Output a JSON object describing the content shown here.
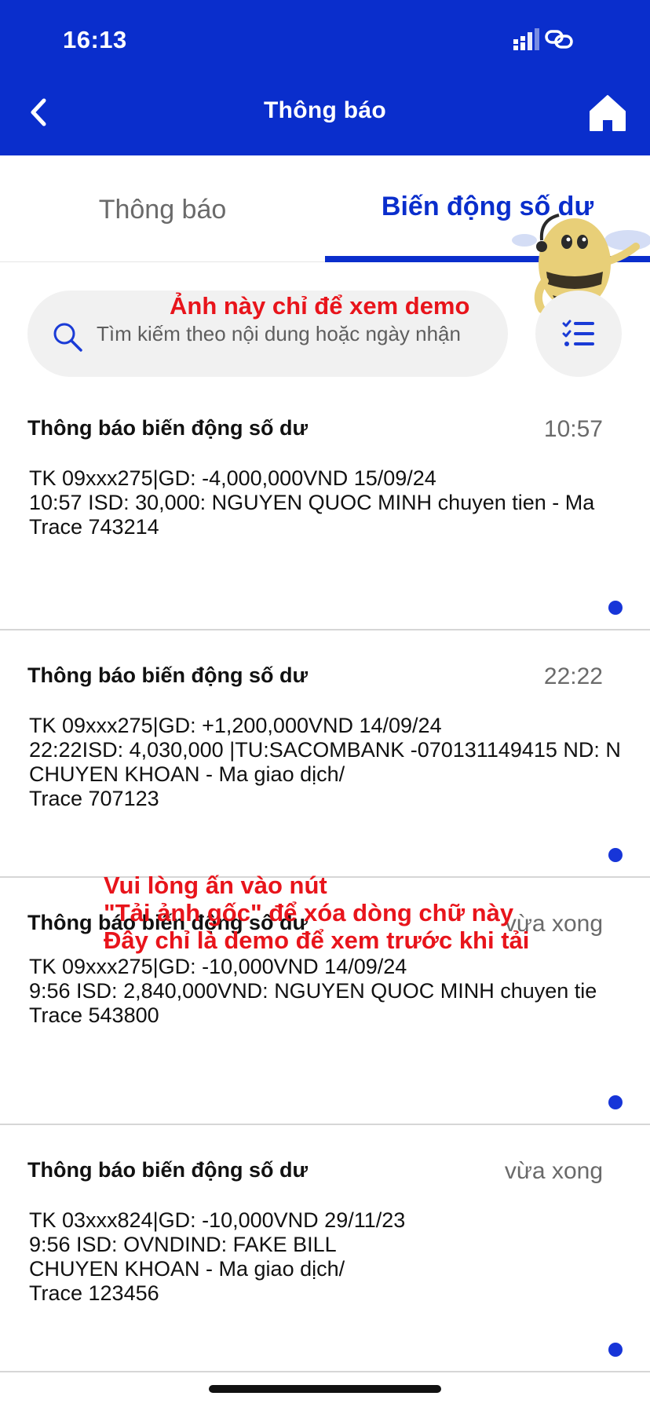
{
  "status_bar": {
    "time": "16:13"
  },
  "header": {
    "title": "Thông báo"
  },
  "tabs": [
    {
      "label": "Thông báo",
      "active": false
    },
    {
      "label": "Biến động số dư",
      "active": true
    }
  ],
  "search": {
    "placeholder": "Tìm kiếm theo nội dung hoặc ngày nhận"
  },
  "demo_watermark": {
    "top": "Ảnh này chỉ để xem demo",
    "middle": "Vui lòng ấn vào nút\n\"Tải ảnh gốc\" để xóa dòng chữ này\nĐây chỉ là demo để xem trước khi tải"
  },
  "notifications": [
    {
      "title": "Thông báo biến động số dư",
      "time": "10:57",
      "body": "TK 09xxx275|GD: -4,000,000VND 15/09/24\n10:57 ISD: 30,000: NGUYEN QUOC MINH chuyen tien - Ma\nTrace 743214",
      "unread": true
    },
    {
      "title": "Thông báo biến động số dư",
      "time": "22:22",
      "body": "TK 09xxx275|GD: +1,200,000VND 14/09/24\n22:22ISD: 4,030,000 |TU:SACOMBANK -070131149415 ND: N\nCHUYEN KHOAN - Ma giao dịch/\nTrace 707123",
      "unread": true
    },
    {
      "title": "Thông báo biến động số dư",
      "time": "vừa xong",
      "body": "TK 09xxx275|GD: -10,000VND 14/09/24\n9:56 ISD: 2,840,000VND: NGUYEN QUOC MINH chuyen tie\nTrace 543800",
      "unread": true
    },
    {
      "title": "Thông báo biến động số dư",
      "time": "vừa xong",
      "body": "TK 03xxx824|GD: -10,000VND 29/11/23\n9:56 ISD: OVNDIND: FAKE BILL\nCHUYEN KHOAN - Ma giao dịch/\nTrace 123456",
      "unread": true
    }
  ],
  "colors": {
    "primary": "#0a2ecc",
    "dot": "#1735d8",
    "watermark": "#e8141b"
  },
  "icons": [
    "chevron-left-icon",
    "home-icon",
    "search-icon",
    "filter-list-icon",
    "signal-icon",
    "link-icon"
  ]
}
